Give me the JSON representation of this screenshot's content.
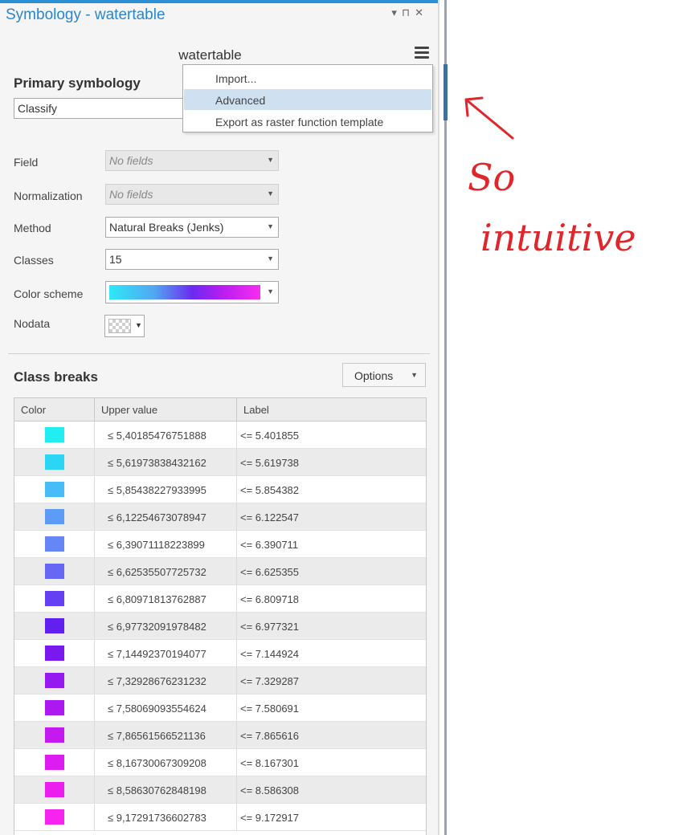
{
  "window": {
    "title": "Symbology - watertable",
    "controls": "▾ ⊓ ✕"
  },
  "layer_name": "watertable",
  "context_menu": {
    "items": [
      "Import...",
      "Advanced",
      "Export as raster function template"
    ],
    "highlighted": "Advanced"
  },
  "primary": {
    "heading": "Primary symbology",
    "value": "Classify"
  },
  "form": {
    "field_label": "Field",
    "field_value": "No fields",
    "normalization_label": "Normalization",
    "normalization_value": "No fields",
    "method_label": "Method",
    "method_value": "Natural Breaks (Jenks)",
    "classes_label": "Classes",
    "classes_value": "15",
    "color_scheme_label": "Color scheme",
    "nodata_label": "Nodata"
  },
  "class_breaks": {
    "heading": "Class breaks",
    "options_label": "Options",
    "columns": [
      "Color",
      "Upper value",
      "Label"
    ],
    "rows": [
      {
        "color": "#22eef2",
        "upper": "≤  5,40185476751888",
        "label": "<= 5.401855"
      },
      {
        "color": "#2ad6f4",
        "upper": "≤  5,61973838432162",
        "label": "<= 5.619738"
      },
      {
        "color": "#48bcf6",
        "upper": "≤  5,85438227933995",
        "label": "<= 5.854382"
      },
      {
        "color": "#5c9cf6",
        "upper": "≤  6,12254673078947",
        "label": "<= 6.122547"
      },
      {
        "color": "#6686f6",
        "upper": "≤  6,39071118223899",
        "label": "<= 6.390711"
      },
      {
        "color": "#6668f4",
        "upper": "≤  6,62535507725732",
        "label": "<= 6.625355"
      },
      {
        "color": "#6440f2",
        "upper": "≤  6,80971813762887",
        "label": "<= 6.809718"
      },
      {
        "color": "#6220f0",
        "upper": "≤  6,97732091978482",
        "label": "<= 6.977321"
      },
      {
        "color": "#7a18f0",
        "upper": "≤  7,14492370194077",
        "label": "<= 7.144924"
      },
      {
        "color": "#961af0",
        "upper": "≤  7,32928676231232",
        "label": "<= 7.329287"
      },
      {
        "color": "#ac18f0",
        "upper": "≤  7,58069093554624",
        "label": "<= 7.580691"
      },
      {
        "color": "#c41af0",
        "upper": "≤  7,86561566521136",
        "label": "<= 7.865616"
      },
      {
        "color": "#dc1cf0",
        "upper": "≤  8,16730067309208",
        "label": "<= 8.167301"
      },
      {
        "color": "#ec1eee",
        "upper": "≤  8,58630762848198",
        "label": "<= 8.586308"
      },
      {
        "color": "#f624ee",
        "upper": "≤  9,17291736602783",
        "label": "<= 9.172917"
      }
    ]
  },
  "annotation": {
    "text": "So intuitive",
    "color": "#e0262b"
  }
}
